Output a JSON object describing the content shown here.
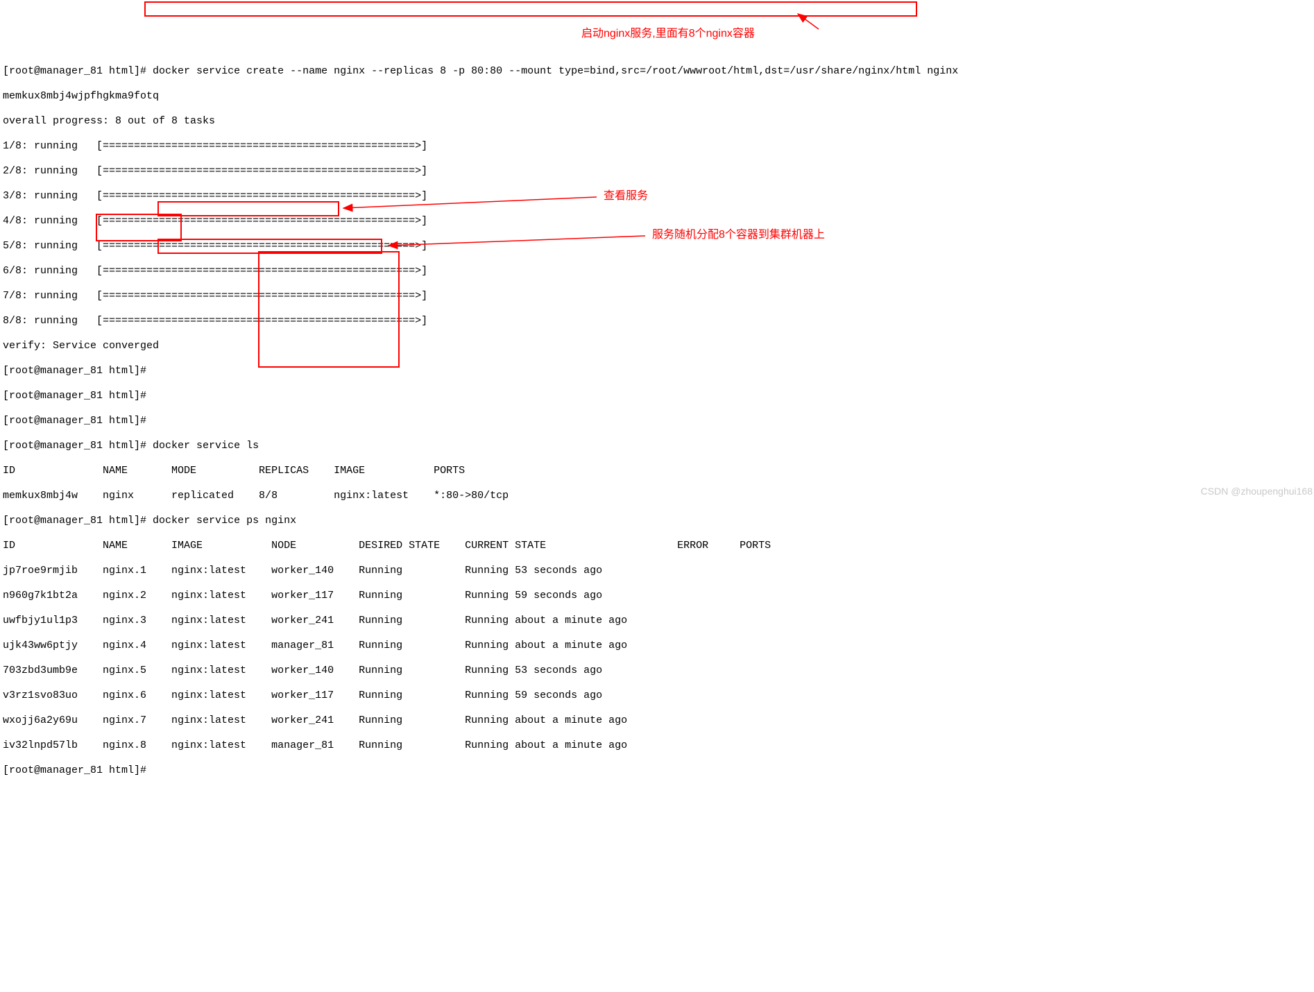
{
  "prompt": "[root@manager_81 html]# ",
  "cmd_create": "docker service create --name nginx --replicas 8 -p 80:80 --mount type=bind,src=/root/wwwroot/html,dst=/usr/share/nginx/html nginx",
  "service_id": "memkux8mbj4wjpfhgkma9fotq",
  "progress_line": "overall progress: 8 out of 8 tasks",
  "tasks": [
    "1/8: running   [==================================================>] ",
    "2/8: running   [==================================================>] ",
    "3/8: running   [==================================================>] ",
    "4/8: running   [==================================================>] ",
    "5/8: running   [==================================================>] ",
    "6/8: running   [==================================================>] ",
    "7/8: running   [==================================================>] ",
    "8/8: running   [==================================================>] "
  ],
  "verify": "verify: Service converged",
  "cmd_ls": "docker service ls",
  "ls_header": "ID              NAME       MODE          REPLICAS    IMAGE           PORTS",
  "ls_row": "memkux8mbj4w    nginx      replicated    8/8         nginx:latest    *:80->80/tcp",
  "cmd_ps": "docker service ps nginx",
  "ps_header": "ID              NAME       IMAGE           NODE          DESIRED STATE    CURRENT STATE                     ERROR     PORTS",
  "ps_rows": [
    "jp7roe9rmjib    nginx.1    nginx:latest    worker_140    Running          Running 53 seconds ago",
    "n960g7k1bt2a    nginx.2    nginx:latest    worker_117    Running          Running 59 seconds ago",
    "uwfbjy1ul1p3    nginx.3    nginx:latest    worker_241    Running          Running about a minute ago",
    "ujk43ww6ptjy    nginx.4    nginx:latest    manager_81    Running          Running about a minute ago",
    "703zbd3umb9e    nginx.5    nginx:latest    worker_140    Running          Running 53 seconds ago",
    "v3rz1svo83uo    nginx.6    nginx:latest    worker_117    Running          Running 59 seconds ago",
    "wxojj6a2y69u    nginx.7    nginx:latest    worker_241    Running          Running about a minute ago",
    "iv32lnpd57lb    nginx.8    nginx:latest    manager_81    Running          Running about a minute ago"
  ],
  "anno1": "启动nginx服务,里面有8个nginx容器",
  "anno2": "查看服务",
  "anno3": "服务随机分配8个容器到集群机器上",
  "watermark": "CSDN @zhoupenghui168"
}
